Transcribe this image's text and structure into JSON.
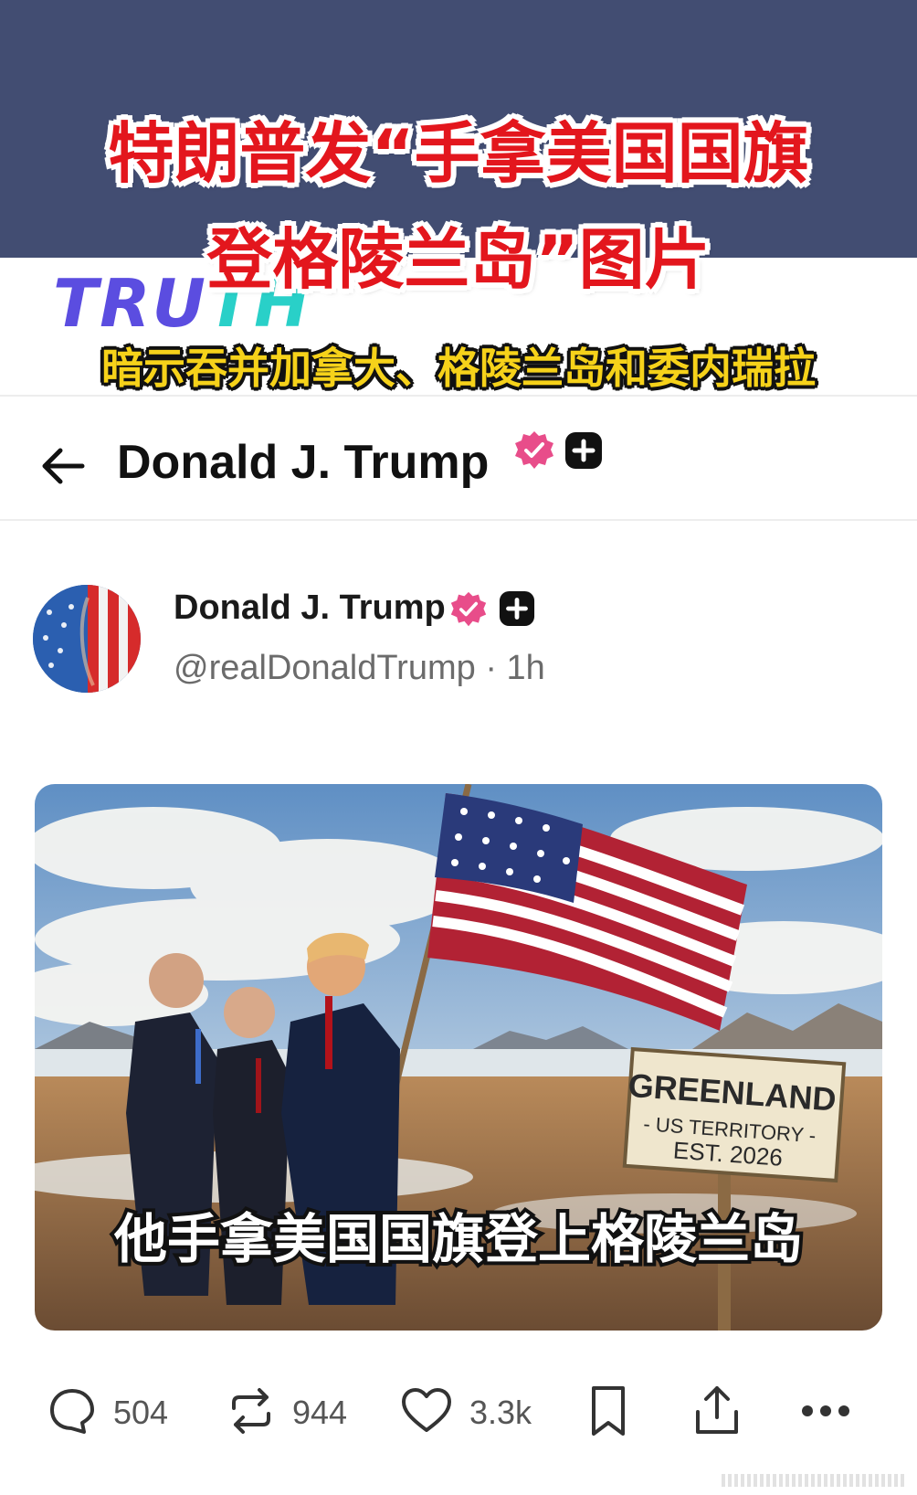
{
  "overlay": {
    "title_line1": "特朗普发“手拿美国国旗",
    "title_line2": "登格陵兰岛”图片",
    "subtitle": "暗示吞并加拿大、格陵兰岛和委内瑞拉",
    "logo_text": "TRUTH"
  },
  "header": {
    "back_icon": "arrow-left-icon",
    "title": "Donald J. Trump",
    "verified_icon": "verified-badge-icon",
    "plus_icon": "plus-badge-icon"
  },
  "post": {
    "author_name": "Donald J. Trump",
    "handle": "@realDonaldTrump",
    "separator": "·",
    "time": "1h",
    "image": {
      "caption": "他手拿美国国旗登上格陵兰岛",
      "sign_line1": "GREENLAND",
      "sign_line2": "- US TERRITORY -",
      "sign_line3": "EST. 2026"
    }
  },
  "actions": {
    "reply": {
      "icon": "comment-icon",
      "count": "504"
    },
    "repost": {
      "icon": "repost-icon",
      "count": "944"
    },
    "like": {
      "icon": "heart-icon",
      "count": "3.3k"
    },
    "bookmark": {
      "icon": "bookmark-icon"
    },
    "share": {
      "icon": "share-icon"
    },
    "more": {
      "icon": "more-icon"
    }
  },
  "colors": {
    "navy_band": "#424d72",
    "title_red": "#e3161d",
    "subtitle_yellow": "#f6d21a",
    "verified_pink": "#e84d8a"
  }
}
